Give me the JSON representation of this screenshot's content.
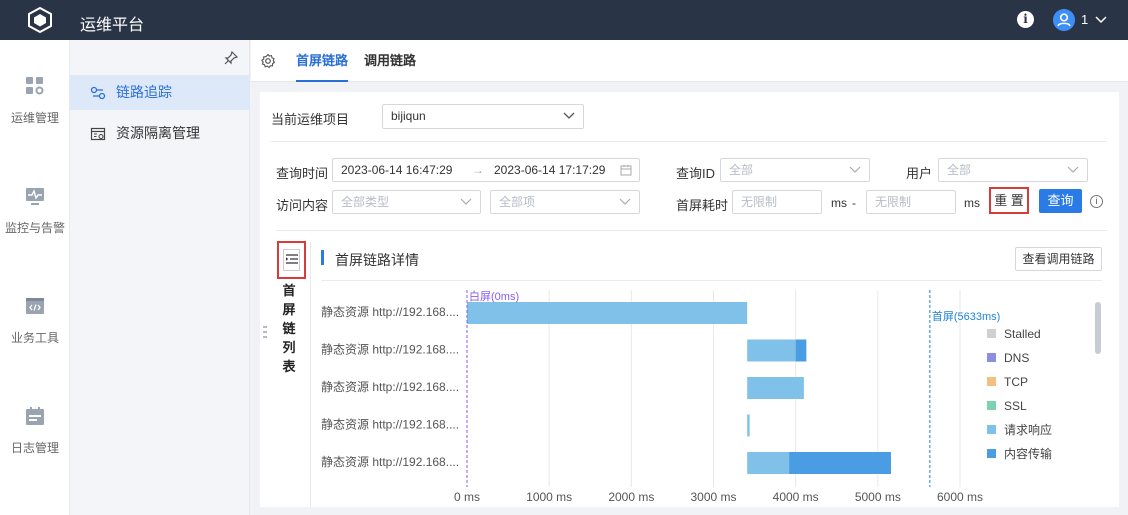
{
  "topbar": {
    "title": "运维平台",
    "user_name": "1"
  },
  "rail": {
    "items": [
      {
        "label": "运维管理",
        "icon": "grid-apps-icon"
      },
      {
        "label": "监控与告警",
        "icon": "monitor-pulse-icon"
      },
      {
        "label": "业务工具",
        "icon": "code-window-icon"
      },
      {
        "label": "日志管理",
        "icon": "calendar-log-icon"
      }
    ]
  },
  "subnav": {
    "items": [
      {
        "label": "链路追踪",
        "active": true,
        "icon": "link-trace-icon"
      },
      {
        "label": "资源隔离管理",
        "active": false,
        "icon": "resource-isolation-icon"
      }
    ]
  },
  "tabs": [
    {
      "label": "首屏链路",
      "active": true
    },
    {
      "label": "调用链路",
      "active": false
    }
  ],
  "filters": {
    "project_label": "当前运维项目",
    "project_value": "bijiqun",
    "time_label": "查询时间",
    "time_start": "2023-06-14 16:47:29",
    "time_end": "2023-06-14 17:17:29",
    "query_id_label": "查询ID",
    "query_id_placeholder": "全部",
    "user_label": "用户",
    "user_placeholder": "全部",
    "visit_label": "访问内容",
    "visit_type_placeholder": "全部类型",
    "visit_item_placeholder": "全部项",
    "duration_label": "首屏耗时",
    "duration_min_placeholder": "无限制",
    "duration_max_placeholder": "无限制",
    "unit_ms": "ms",
    "range_dash": "-",
    "reset_label": "重 置",
    "query_label": "查询"
  },
  "list_panel": {
    "label": "首屏链列表"
  },
  "detail": {
    "title": "首屏链路详情",
    "view_button": "查看调用链路"
  },
  "chart_data": {
    "type": "bar",
    "subtype": "stacked-horizontal-gantt",
    "categories": [
      "静态资源 http://192.168....",
      "静态资源 http://192.168....",
      "静态资源 http://192.168....",
      "静态资源 http://192.168....",
      "静态资源 http://192.168...."
    ],
    "series": [
      {
        "name": "Stalled",
        "color": "#d0d0d0",
        "segments": [
          [
            0,
            0
          ],
          [
            0,
            0
          ],
          [
            0,
            0
          ],
          [
            0,
            0
          ],
          [
            0,
            0
          ]
        ]
      },
      {
        "name": "DNS",
        "color": "#8a8fe0",
        "segments": [
          [
            0,
            0
          ],
          [
            0,
            0
          ],
          [
            0,
            0
          ],
          [
            0,
            0
          ],
          [
            0,
            0
          ]
        ]
      },
      {
        "name": "TCP",
        "color": "#f5bf82",
        "segments": [
          [
            0,
            0
          ],
          [
            0,
            0
          ],
          [
            0,
            0
          ],
          [
            0,
            0
          ],
          [
            0,
            0
          ]
        ]
      },
      {
        "name": "SSL",
        "color": "#7dd3b0",
        "segments": [
          [
            0,
            0
          ],
          [
            0,
            0
          ],
          [
            0,
            0
          ],
          [
            0,
            0
          ],
          [
            0,
            0
          ]
        ]
      },
      {
        "name": "请求响应",
        "color": "#7fc1e9",
        "segments": [
          [
            0,
            3410
          ],
          [
            3410,
            4000
          ],
          [
            3410,
            4100
          ],
          [
            3410,
            3440
          ],
          [
            3410,
            3920
          ]
        ]
      },
      {
        "name": "内容传输",
        "color": "#4a9ce3",
        "segments": [
          [
            3410,
            3410
          ],
          [
            4000,
            4130
          ],
          [
            4100,
            4100
          ],
          [
            3440,
            3440
          ],
          [
            3920,
            5160
          ]
        ]
      }
    ],
    "markers": [
      {
        "label": "白屏(0ms)",
        "x": 0,
        "color": "#8a5cf0"
      },
      {
        "label": "首屏(5633ms)",
        "x": 5633,
        "color": "#1f84d6"
      }
    ],
    "x_ticks": [
      "0 ms",
      "1000 ms",
      "2000 ms",
      "3000 ms",
      "4000 ms",
      "5000 ms",
      "6000 ms"
    ],
    "xlim": [
      0,
      6000
    ],
    "xlabel": "",
    "ylabel": "",
    "grid": true,
    "legend_position": "right"
  }
}
